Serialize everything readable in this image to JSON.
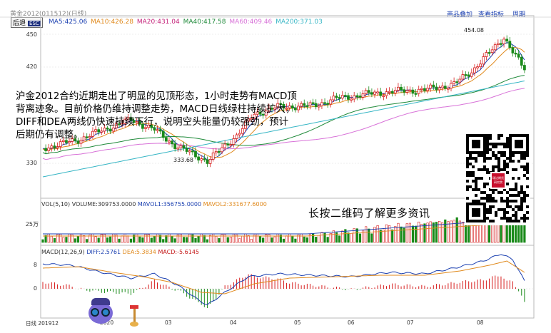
{
  "window": {
    "title": "黄金2012(011512)(日线)",
    "links": [
      "商品叠加",
      "查看指标",
      "周期"
    ],
    "after_button": "后退",
    "esc_label": "ESC"
  },
  "ma_legend": [
    {
      "label": "MA5:425.06",
      "color": "#1a3fb0"
    },
    {
      "label": "MA10:426.28",
      "color": "#e08a1e"
    },
    {
      "label": "MA20:431.04",
      "color": "#c4237a"
    },
    {
      "label": "MA40:417.58",
      "color": "#1f8a3a"
    },
    {
      "label": "MA60:409.46",
      "color": "#d872d8"
    },
    {
      "label": "MA200:371.03",
      "color": "#37b6c5"
    }
  ],
  "price_axis": [
    "450",
    "420",
    "330"
  ],
  "price_annotations": {
    "high": "454.08",
    "low": "333.68"
  },
  "annotation_text": "沪金2012合约近期走出了明显的见顶形态，1小时走势有MACD顶背离迹象。目前价格仍维持调整走势，MACD日线绿柱持续扩大，DIFF和DEA两线仍快速持续下行，说明空头能量仍较强劲，预计后期仍有调整。",
  "promo_text": "长按二维码了解更多资讯",
  "volume": {
    "legend": [
      {
        "label": "VOL(5,10)",
        "color": "#333333"
      },
      {
        "label": "VOLUME:309753.0000",
        "color": "#333333"
      },
      {
        "label": "MAVOL1:356755.0000",
        "color": "#1a3fb0"
      },
      {
        "label": "MAVOL2:331677.6000",
        "color": "#e08a1e"
      }
    ],
    "axis_label": "25万"
  },
  "macd": {
    "legend": [
      {
        "label": "MACD(12,26,9)",
        "color": "#333333"
      },
      {
        "label": "DIFF:2.5761",
        "color": "#1a3fb0"
      },
      {
        "label": "DEA:5.3834",
        "color": "#e08a1e"
      },
      {
        "label": "MACD:-5.6145",
        "color": "#c41a1a"
      }
    ],
    "axis": [
      "8",
      "0"
    ]
  },
  "x_axis": [
    "日线 201912",
    "2020",
    "03",
    "04",
    "05",
    "06",
    "07",
    "08"
  ],
  "qr": {
    "badge_line1": "瑞达期货",
    "badge_line2": "研究院"
  },
  "colors": {
    "up": "#d61c1c",
    "down": "#1a8a1a",
    "ma5": "#1a3fb0",
    "ma10": "#e08a1e",
    "ma40": "#1f8a3a",
    "ma60": "#d872d8",
    "ma200": "#37b6c5"
  }
}
